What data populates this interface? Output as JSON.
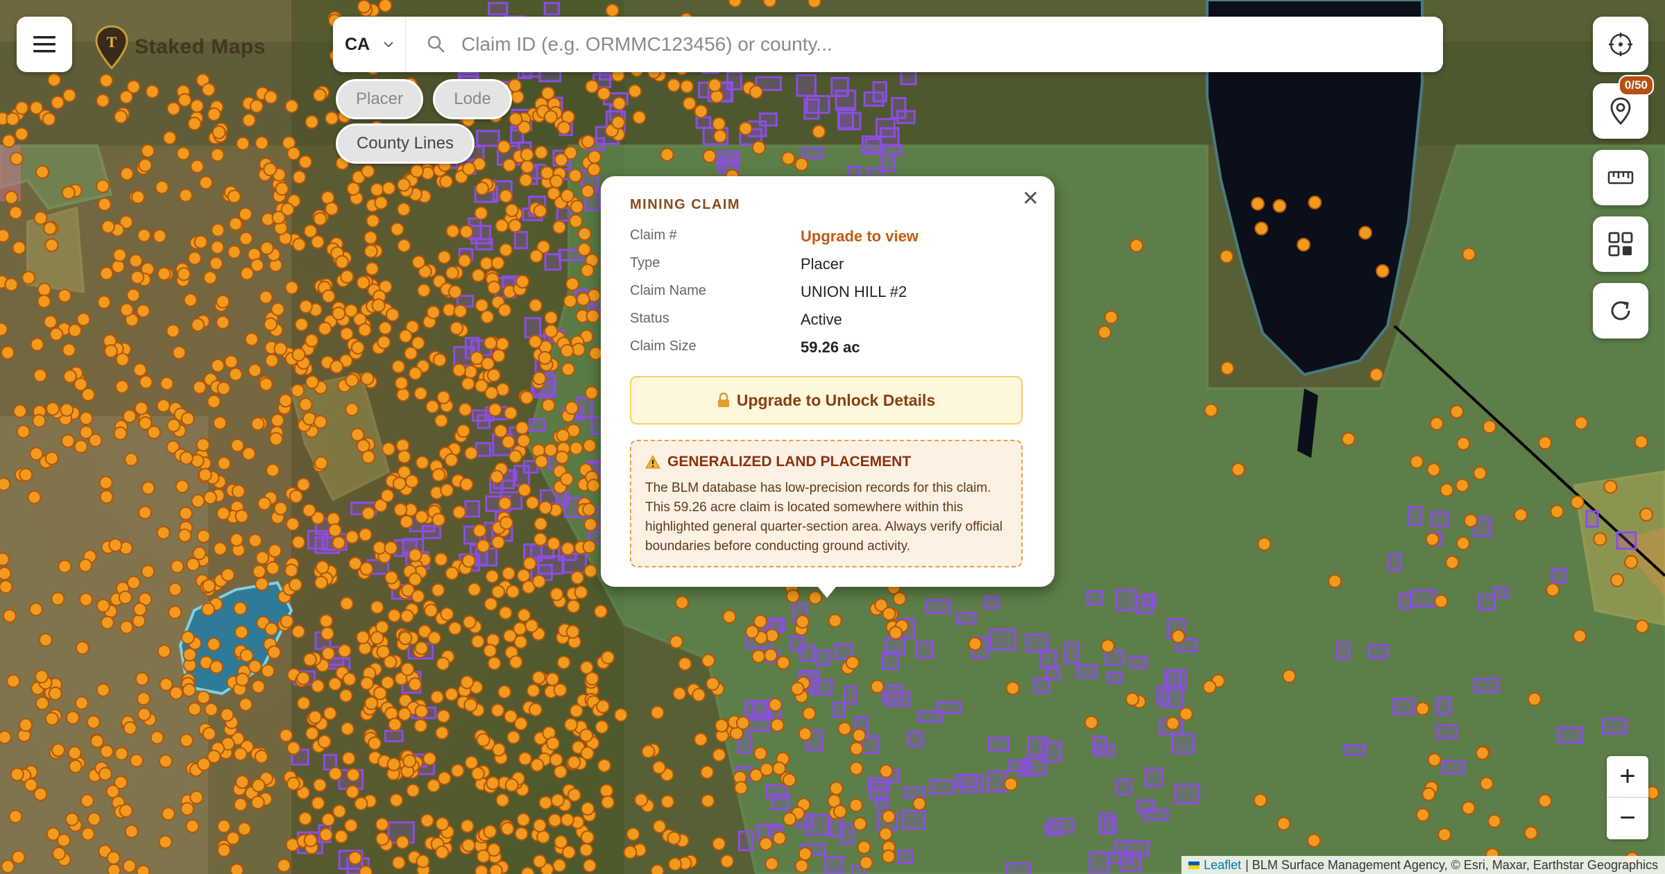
{
  "app": {
    "name": "Staked Maps"
  },
  "search": {
    "state": "CA",
    "placeholder": "Claim ID (e.g. ORMMC123456) or county..."
  },
  "filters": [
    {
      "label": "Placer",
      "active": false
    },
    {
      "label": "Lode",
      "active": false
    },
    {
      "label": "County Lines",
      "active": true
    }
  ],
  "right_toolbar": {
    "saved_badge": "0/50"
  },
  "icons": [
    "menu-icon",
    "logo-pin-icon",
    "chevron-down-icon",
    "search-icon",
    "locate-icon",
    "pin-icon",
    "ruler-icon",
    "grid-icon",
    "refresh-icon",
    "close-icon",
    "lock-icon",
    "warning-icon"
  ],
  "popup": {
    "title": "MINING CLAIM",
    "rows": [
      {
        "label": "Claim #",
        "value": "Upgrade to view"
      },
      {
        "label": "Type",
        "value": "Placer"
      },
      {
        "label": "Claim Name",
        "value": "UNION HILL #2"
      },
      {
        "label": "Status",
        "value": "Active"
      },
      {
        "label": "Claim Size",
        "value": "59.26 ac"
      }
    ],
    "upgrade_button": "Upgrade to Unlock Details",
    "warning_title": "GENERALIZED LAND PLACEMENT",
    "warning_text": "The BLM database has low-precision records for this claim. This 59.26 acre claim is located somewhere within this highlighted general quarter-section area. Always verify official boundaries before conducting ground activity."
  },
  "zoom": {
    "in": "+",
    "out": "−"
  },
  "attribution": {
    "leaflet": "Leaflet",
    "rest": "| BLM Surface Management Agency, © Esri, Maxar, Earthstar Geographics"
  },
  "colors": {
    "accent": "#c25a12",
    "claim_dot": "#f29a1e",
    "lode_box": "#8b4fe0",
    "federal_land": "#6cbf73",
    "water": "#0a0f1a"
  }
}
